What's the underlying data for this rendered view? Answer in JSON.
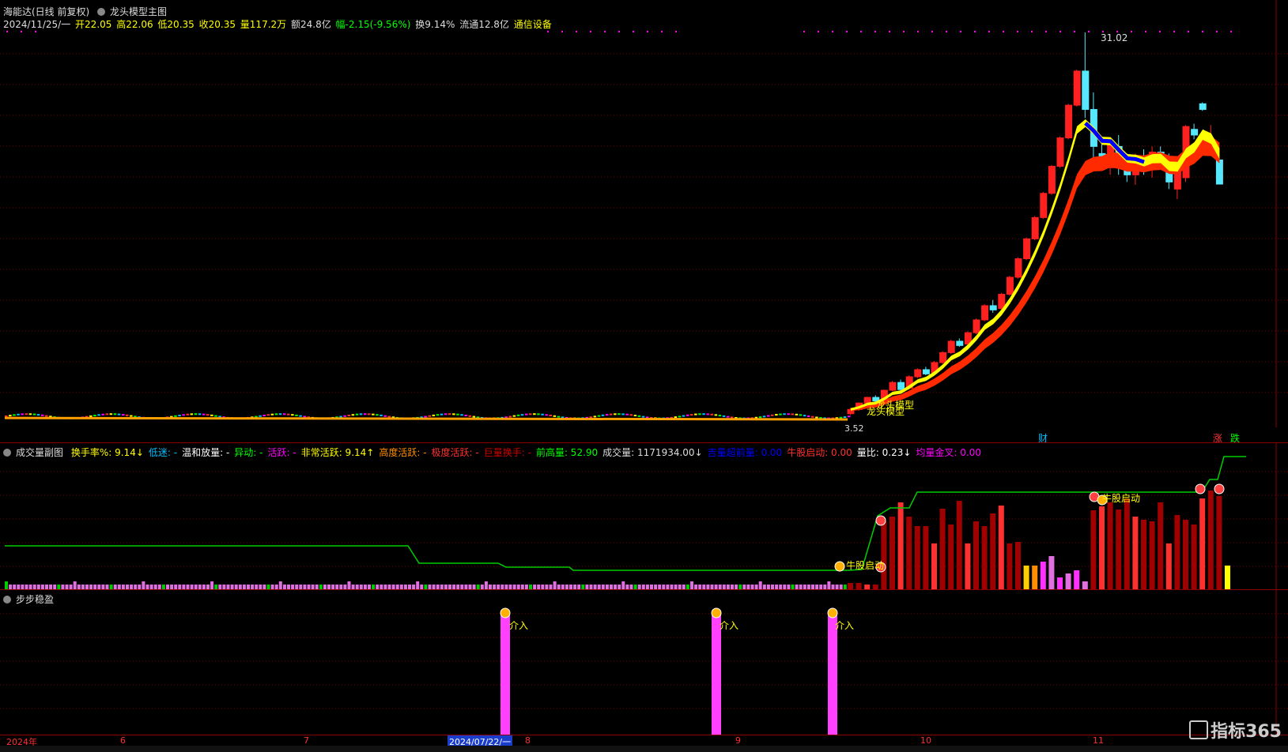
{
  "header": {
    "stock": "海能达(日线 前复权)",
    "indicator": "龙头模型主图",
    "date": "2024/11/25/一",
    "open": "开22.05",
    "high": "高22.06",
    "low": "低20.35",
    "close": "收20.35",
    "vol": "量117.2万",
    "amount": "额24.8亿",
    "change": "幅-2.15(-9.56%)",
    "turnover": "换9.14%",
    "float": "流通12.8亿",
    "sector": "通信设备"
  },
  "main_annotations": {
    "high_price": "31.02",
    "low_price": "3.52",
    "cai": "财",
    "zhang": "涨",
    "die": "跌",
    "longtou1": "龙头模型",
    "longtou2": "龙头模型"
  },
  "pane2": {
    "title": "成交量副图",
    "items": [
      {
        "label": "换手率%: 9.14↓",
        "color": "#ffff00"
      },
      {
        "label": "低迷: -",
        "color": "#00bfff"
      },
      {
        "label": "温和放量: -",
        "color": "#ffffff"
      },
      {
        "label": "异动: -",
        "color": "#00ff00"
      },
      {
        "label": "活跃: -",
        "color": "#ff00ff"
      },
      {
        "label": "非常活跃: 9.14↑",
        "color": "#ffff00"
      },
      {
        "label": "高度活跃: -",
        "color": "#ff8c00"
      },
      {
        "label": "极度活跃: -",
        "color": "#ff3030"
      },
      {
        "label": "巨量换手: -",
        "color": "#cc0000"
      },
      {
        "label": "前高量: 52.90",
        "color": "#00ff00"
      },
      {
        "label": "成交量: 1171934.00↓",
        "color": "#dddddd"
      },
      {
        "label": "吉量超前量: 0.00",
        "color": "#0000ff"
      },
      {
        "label": "牛股启动: 0.00",
        "color": "#ff3030"
      },
      {
        "label": "量比: 0.23↓",
        "color": "#ffffff"
      },
      {
        "label": "均量金叉: 0.00",
        "color": "#ff00ff"
      }
    ],
    "niugu1": "牛股启动",
    "niugu2": "牛股启动"
  },
  "pane3": {
    "title": "步步稳盈",
    "signal_label": "介入"
  },
  "xaxis": {
    "labels": [
      "2024年",
      "6",
      "7",
      "2024/07/22/一",
      "8",
      "9",
      "10",
      "11"
    ]
  },
  "watermark": "指标365",
  "chart_data": {
    "type": "candlestick",
    "title": "海能达(日线 前复权)",
    "price_range": [
      3.52,
      31.02
    ],
    "y_annotations": {
      "max": 31.02,
      "min": 3.52
    },
    "candles_recent": [
      {
        "o": 4.2,
        "h": 4.6,
        "l": 4.1,
        "c": 4.5
      },
      {
        "o": 4.5,
        "h": 5.0,
        "l": 4.4,
        "c": 4.95
      },
      {
        "o": 4.95,
        "h": 5.4,
        "l": 4.9,
        "c": 5.35
      },
      {
        "o": 5.35,
        "h": 5.5,
        "l": 5.0,
        "c": 5.1
      },
      {
        "o": 5.2,
        "h": 5.9,
        "l": 5.1,
        "c": 5.85
      },
      {
        "o": 5.85,
        "h": 6.5,
        "l": 5.8,
        "c": 6.4
      },
      {
        "o": 6.4,
        "h": 6.6,
        "l": 5.8,
        "c": 5.9
      },
      {
        "o": 6.0,
        "h": 6.9,
        "l": 5.9,
        "c": 6.8
      },
      {
        "o": 6.8,
        "h": 7.4,
        "l": 6.7,
        "c": 7.3
      },
      {
        "o": 7.3,
        "h": 7.5,
        "l": 6.9,
        "c": 7.0
      },
      {
        "o": 7.1,
        "h": 7.9,
        "l": 7.0,
        "c": 7.8
      },
      {
        "o": 7.8,
        "h": 8.6,
        "l": 7.7,
        "c": 8.5
      },
      {
        "o": 8.5,
        "h": 9.4,
        "l": 8.4,
        "c": 9.3
      },
      {
        "o": 9.3,
        "h": 9.5,
        "l": 8.9,
        "c": 9.0
      },
      {
        "o": 9.1,
        "h": 10.0,
        "l": 9.0,
        "c": 9.9
      },
      {
        "o": 9.9,
        "h": 10.9,
        "l": 9.8,
        "c": 10.8
      },
      {
        "o": 10.8,
        "h": 11.9,
        "l": 10.7,
        "c": 11.8
      },
      {
        "o": 11.8,
        "h": 12.2,
        "l": 11.3,
        "c": 11.5
      },
      {
        "o": 11.6,
        "h": 12.7,
        "l": 11.5,
        "c": 12.6
      },
      {
        "o": 12.6,
        "h": 13.9,
        "l": 12.5,
        "c": 13.8
      },
      {
        "o": 13.8,
        "h": 15.2,
        "l": 13.7,
        "c": 15.1
      },
      {
        "o": 15.1,
        "h": 16.6,
        "l": 15.0,
        "c": 16.5
      },
      {
        "o": 16.5,
        "h": 18.1,
        "l": 16.4,
        "c": 18.0
      },
      {
        "o": 18.0,
        "h": 19.8,
        "l": 17.9,
        "c": 19.7
      },
      {
        "o": 19.7,
        "h": 21.7,
        "l": 19.6,
        "c": 21.6
      },
      {
        "o": 21.6,
        "h": 23.7,
        "l": 21.5,
        "c": 23.6
      },
      {
        "o": 23.6,
        "h": 26.0,
        "l": 23.5,
        "c": 25.9
      },
      {
        "o": 25.9,
        "h": 28.4,
        "l": 25.8,
        "c": 28.3
      },
      {
        "o": 28.3,
        "h": 31.02,
        "l": 25.0,
        "c": 25.6
      },
      {
        "o": 25.6,
        "h": 26.8,
        "l": 22.0,
        "c": 23.0
      },
      {
        "o": 22.5,
        "h": 23.5,
        "l": 21.5,
        "c": 22.0
      },
      {
        "o": 21.5,
        "h": 23.5,
        "l": 21.0,
        "c": 23.3
      },
      {
        "o": 23.0,
        "h": 23.8,
        "l": 21.0,
        "c": 21.5
      },
      {
        "o": 21.5,
        "h": 22.5,
        "l": 20.5,
        "c": 21.0
      },
      {
        "o": 21.0,
        "h": 22.5,
        "l": 20.3,
        "c": 22.0
      },
      {
        "o": 22.0,
        "h": 22.8,
        "l": 21.0,
        "c": 21.5
      },
      {
        "o": 21.5,
        "h": 23.0,
        "l": 20.8,
        "c": 22.6
      },
      {
        "o": 22.6,
        "h": 23.0,
        "l": 21.8,
        "c": 22.2
      },
      {
        "o": 22.2,
        "h": 22.5,
        "l": 20.0,
        "c": 20.5
      },
      {
        "o": 20.0,
        "h": 22.0,
        "l": 19.3,
        "c": 21.5
      },
      {
        "o": 20.8,
        "h": 24.5,
        "l": 20.5,
        "c": 24.4
      },
      {
        "o": 24.2,
        "h": 24.6,
        "l": 23.5,
        "c": 23.8
      },
      {
        "o": 26.0,
        "h": 26.1,
        "l": 25.5,
        "c": 25.6
      },
      {
        "o": 22.9,
        "h": 24.5,
        "l": 22.5,
        "c": 23.0
      },
      {
        "o": 22.05,
        "h": 22.06,
        "l": 20.35,
        "c": 20.35
      }
    ],
    "volume_pane_title": "成交量副图",
    "signal_pane_title": "步步稳盈",
    "signals": [
      {
        "x_label": "7月",
        "label": "介入"
      },
      {
        "x_label": "9月",
        "label": "介入"
      },
      {
        "x_label": "9月",
        "label": "介入"
      }
    ]
  }
}
